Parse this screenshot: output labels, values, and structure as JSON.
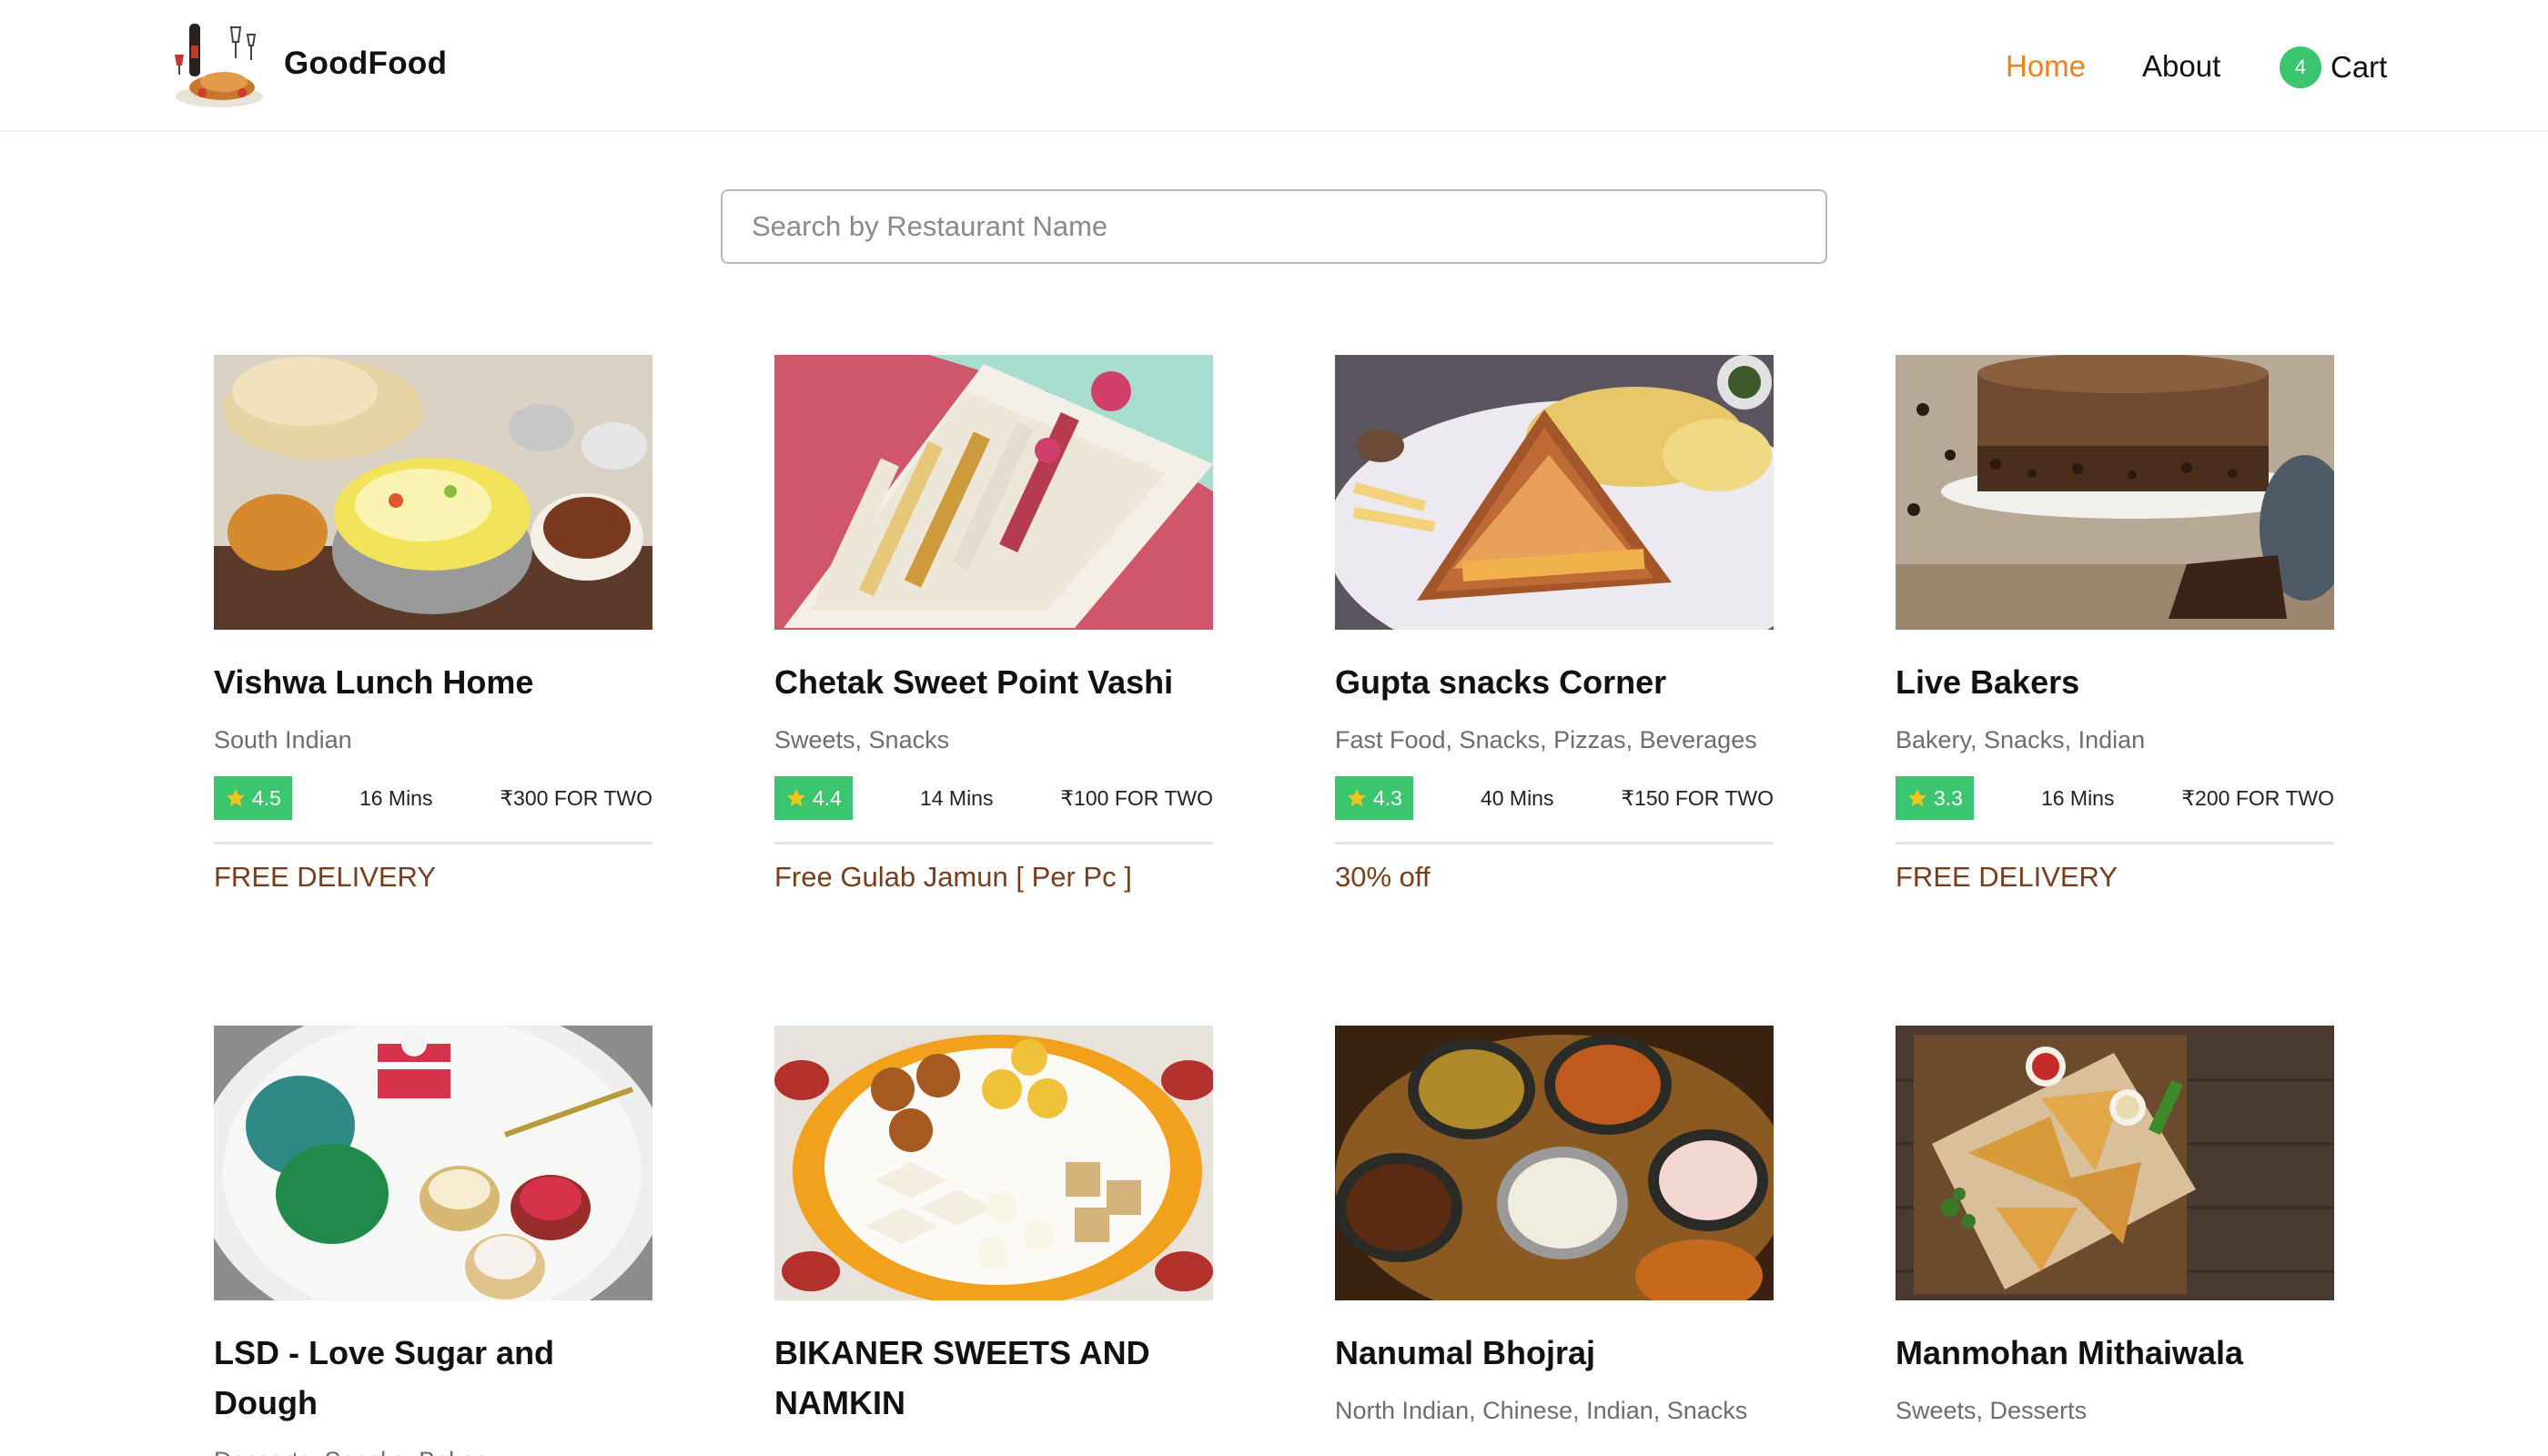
{
  "header": {
    "brand": "GoodFood",
    "nav": {
      "home": "Home",
      "about": "About",
      "cart": "Cart"
    },
    "cart_count": "4",
    "active_color": "#f0801f"
  },
  "search": {
    "placeholder": "Search by Restaurant Name",
    "value": ""
  },
  "colors": {
    "rating_bg": "#3bc56f",
    "offer_text": "#7a3d1c",
    "accent": "#f0801f"
  },
  "restaurants": [
    {
      "name": "Vishwa Lunch Home",
      "cuisine": "South Indian",
      "rating": "4.5",
      "time": "16 Mins",
      "cost": "₹300 FOR TWO",
      "offer": "FREE DELIVERY",
      "image": "biryani-thali"
    },
    {
      "name": "Chetak Sweet Point Vashi",
      "cuisine": "Sweets, Snacks",
      "rating": "4.4",
      "time": "14 Mins",
      "cost": "₹100 FOR TWO",
      "offer": "Free Gulab Jamun [ Per Pc ]",
      "image": "sweets-box"
    },
    {
      "name": "Gupta snacks Corner",
      "cuisine": "Fast Food, Snacks, Pizzas, Beverages",
      "rating": "4.3",
      "time": "40 Mins",
      "cost": "₹150 FOR TWO",
      "offer": "30% off",
      "image": "grilled-sandwich"
    },
    {
      "name": "Live Bakers",
      "cuisine": "Bakery, Snacks, Indian",
      "rating": "3.3",
      "time": "16 Mins",
      "cost": "₹200 FOR TWO",
      "offer": "FREE DELIVERY",
      "image": "chocolate-cake"
    },
    {
      "name": "LSD - Love Sugar and Dough",
      "cuisine": "Desserts, Snacks, Bakery",
      "image": "macarons-cupcakes"
    },
    {
      "name": "BIKANER SWEETS AND NAMKIN",
      "cuisine": "",
      "image": "sweets-platter"
    },
    {
      "name": "Nanumal Bhojraj",
      "cuisine": "North Indian, Chinese, Indian, Snacks",
      "image": "curry-bowls"
    },
    {
      "name": "Manmohan Mithaiwala",
      "cuisine": "Sweets, Desserts",
      "image": "samosa-board"
    }
  ]
}
